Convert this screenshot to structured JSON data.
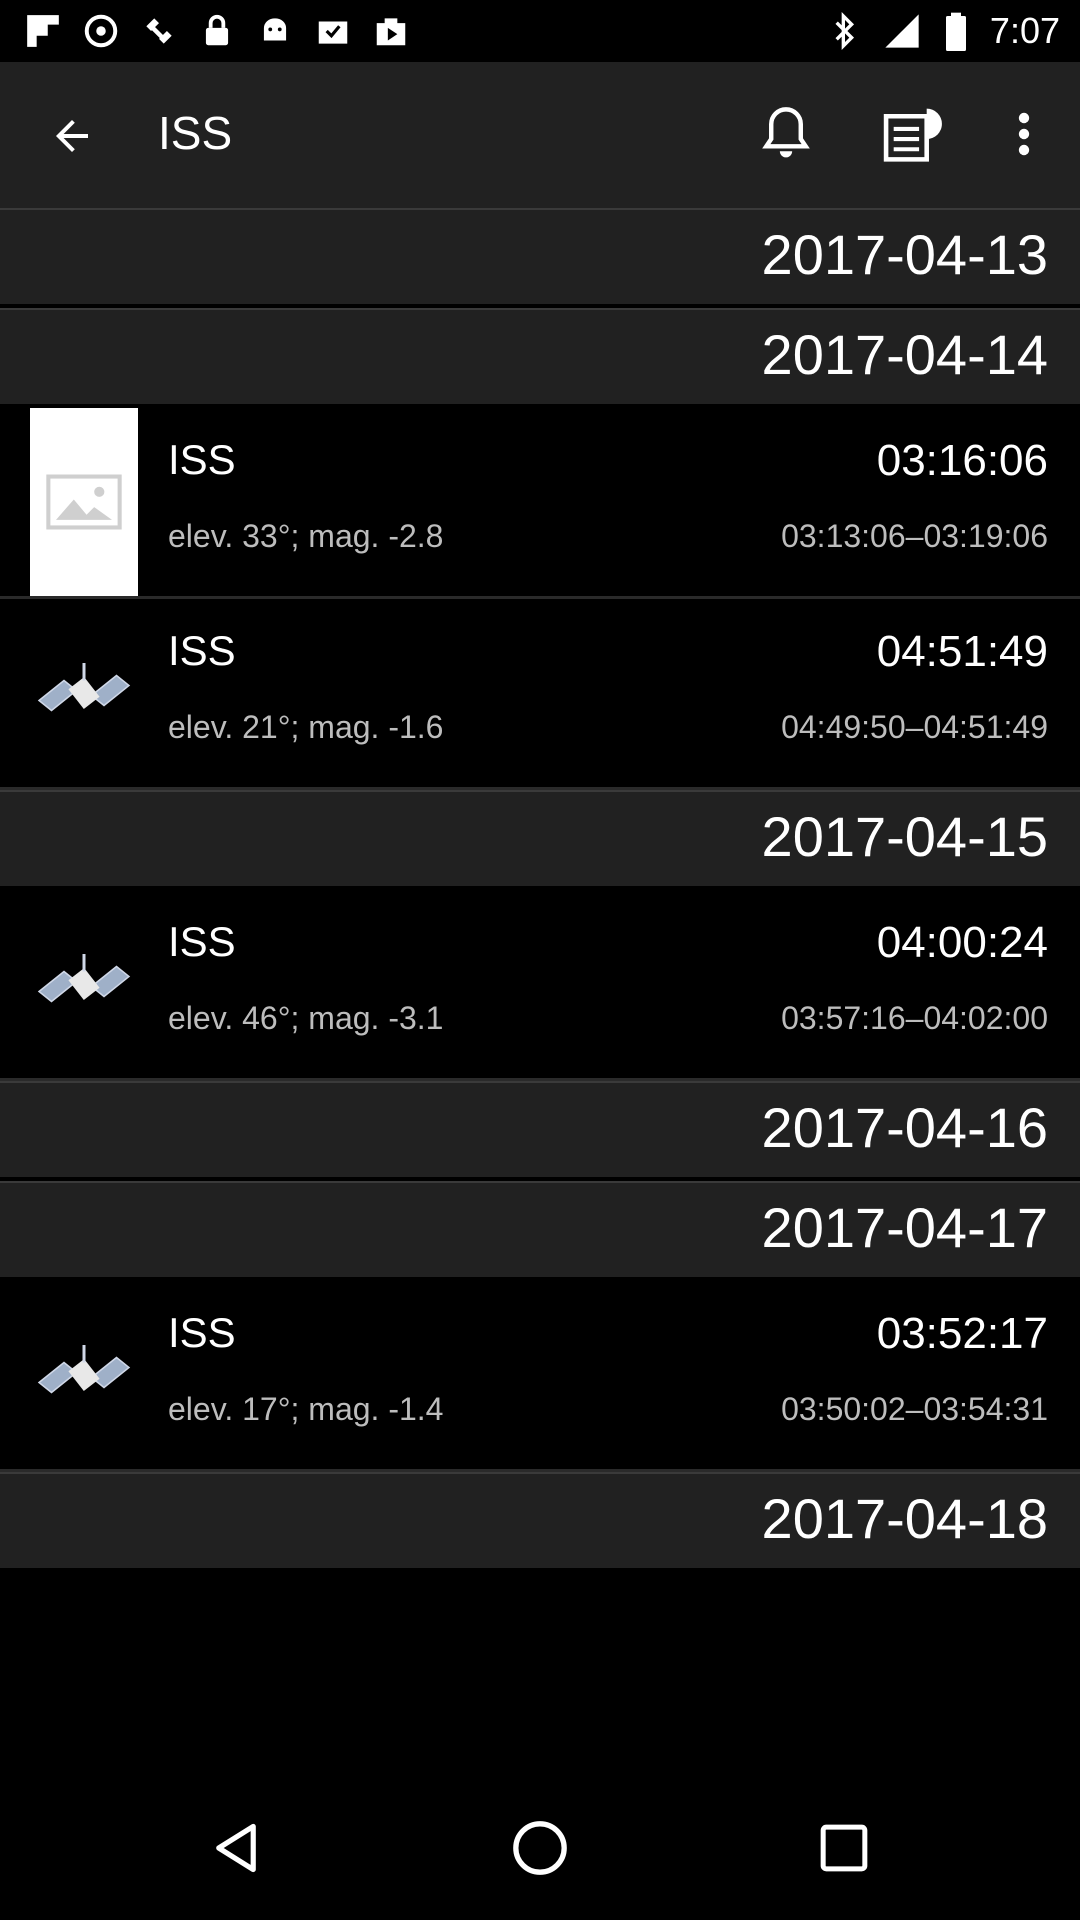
{
  "status_bar": {
    "time": "7:07",
    "left_icons": [
      "flipboard-icon",
      "sync-icon",
      "satellite-icon",
      "lock-icon",
      "android-icon",
      "inbox-icon",
      "play-store-icon"
    ],
    "right_icons": [
      "bluetooth-icon",
      "signal-icon",
      "battery-icon"
    ]
  },
  "app_bar": {
    "title": "ISS",
    "back_icon": "arrow-back-icon",
    "actions": [
      "bell-icon",
      "news-icon",
      "more-vert-icon"
    ]
  },
  "list": [
    {
      "type": "date",
      "date": "2017-04-13"
    },
    {
      "type": "date",
      "date": "2017-04-14"
    },
    {
      "type": "pass",
      "thumb": "image-placeholder-icon",
      "name": "ISS",
      "time": "03:16:06",
      "detail": "elev. 33°; mag. -2.8",
      "range": "03:13:06–03:19:06"
    },
    {
      "type": "pass",
      "thumb": "satellite-icon",
      "name": "ISS",
      "time": "04:51:49",
      "detail": "elev. 21°; mag. -1.6",
      "range": "04:49:50–04:51:49"
    },
    {
      "type": "date",
      "date": "2017-04-15"
    },
    {
      "type": "pass",
      "thumb": "satellite-icon",
      "name": "ISS",
      "time": "04:00:24",
      "detail": "elev. 46°; mag. -3.1",
      "range": "03:57:16–04:02:00"
    },
    {
      "type": "date",
      "date": "2017-04-16"
    },
    {
      "type": "date",
      "date": "2017-04-17"
    },
    {
      "type": "pass",
      "thumb": "satellite-icon",
      "name": "ISS",
      "time": "03:52:17",
      "detail": "elev. 17°; mag. -1.4",
      "range": "03:50:02–03:54:31"
    },
    {
      "type": "date",
      "date": "2017-04-18"
    }
  ],
  "nav_bar": [
    "back-triangle-icon",
    "home-circle-icon",
    "recents-square-icon"
  ],
  "colors": {
    "background": "#000000",
    "header": "#212121",
    "secondary_text": "#bdbdbd"
  }
}
